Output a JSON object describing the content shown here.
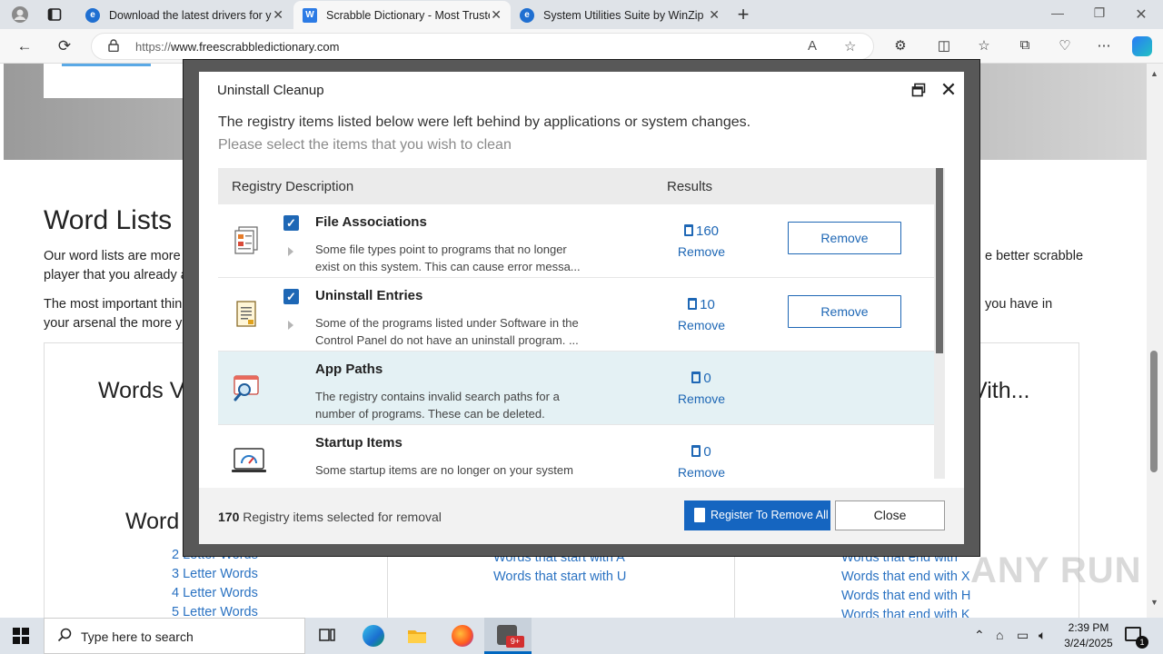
{
  "browser": {
    "tabs": [
      {
        "title": "Download the latest drivers for y",
        "favicon": "edge-icon"
      },
      {
        "title": "Scrabble Dictionary - Most Truste",
        "favicon": "w-icon"
      },
      {
        "title": "System Utilities Suite by WinZip",
        "favicon": "edge-icon"
      }
    ],
    "url_prefix": "https://",
    "url_host": "www.freescrabbledictionary.com"
  },
  "page": {
    "heading": "Word Lists",
    "para1_a": "Our word lists are more",
    "para1_b": "player that you already a",
    "para1_right": "e better scrabble",
    "para2_a": "The most important thin",
    "para2_b": "your arsenal the more y",
    "para2_right": "you have in",
    "panel_h_left": "Words V",
    "panel_h_right": "Vith...",
    "panel_h2": "Word",
    "links_col1": [
      "2 Letter Words",
      "3 Letter Words",
      "4 Letter Words",
      "5 Letter Words"
    ],
    "links_col2": [
      "Words that start with A",
      "Words that start with U"
    ],
    "links_col3": [
      "Words that end with",
      "Words that end with X",
      "Words that end with H",
      "Words that end with K"
    ]
  },
  "dialog": {
    "title": "Uninstall Cleanup",
    "subtitle": "The registry items listed below were left behind by applications or system changes.",
    "instruction": "Please select the items that you wish to clean",
    "columns": [
      "Registry Description",
      "Results"
    ],
    "rows": [
      {
        "name": "File Associations",
        "desc_line1": "Some file types point to programs that no longer",
        "desc_line2": "exist on this system. This can cause error messa...",
        "count": "160",
        "link": "Remove",
        "button": "Remove",
        "checked": true,
        "icon": "file-associations-icon"
      },
      {
        "name": "Uninstall Entries",
        "desc_line1": "Some of the programs listed under Software in the",
        "desc_line2": "Control Panel do not have an uninstall program. ...",
        "count": "10",
        "link": "Remove",
        "button": "Remove",
        "checked": true,
        "icon": "uninstall-entries-icon"
      },
      {
        "name": "App Paths",
        "desc_line1": "The registry contains invalid search paths for a",
        "desc_line2": "number of programs. These can be deleted.",
        "count": "0",
        "link": "Remove",
        "checked": false,
        "icon": "app-paths-icon"
      },
      {
        "name": "Startup Items",
        "desc_line1": "Some startup items are no longer on your system",
        "desc_line2": "",
        "count": "0",
        "link": "Remove",
        "checked": false,
        "icon": "startup-items-icon"
      }
    ],
    "footer_count": "170",
    "footer_text": " Registry items selected for removal",
    "register_button": "Register To Remove All",
    "close_button": "Close"
  },
  "watermark": "ANY RUN",
  "taskbar": {
    "search_placeholder": "Type here to search",
    "time": "2:39 PM",
    "date": "3/24/2025",
    "notification_count": "1"
  },
  "colors": {
    "accent": "#1e67b5",
    "primary_button": "#1565c0",
    "row_highlight": "#e4f1f4"
  }
}
